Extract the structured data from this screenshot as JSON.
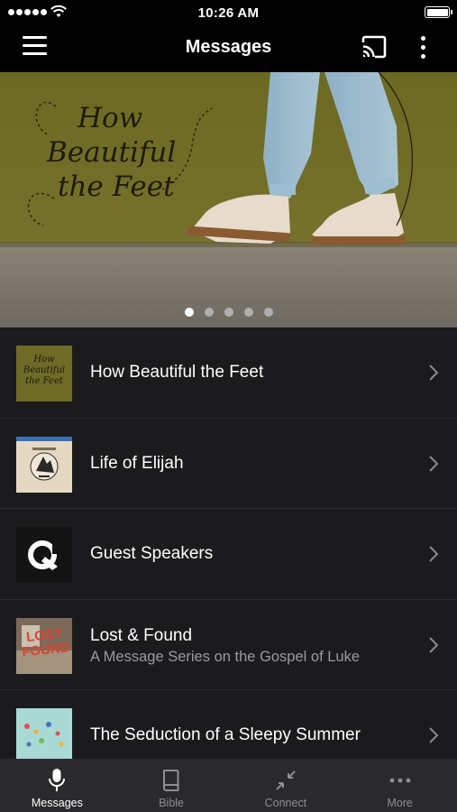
{
  "status_bar": {
    "time": "10:26 AM"
  },
  "nav": {
    "title": "Messages"
  },
  "hero": {
    "caption_line1": "How",
    "caption_line2": "Beautiful",
    "caption_line3": "the Feet",
    "page_count": 5,
    "active_page": 1
  },
  "messages": [
    {
      "title": "How Beautiful the Feet",
      "subtitle": "",
      "thumb_text": "How Beautiful the Feet"
    },
    {
      "title": "Life of Elijah",
      "subtitle": ""
    },
    {
      "title": "Guest Speakers",
      "subtitle": ""
    },
    {
      "title": "Lost & Found",
      "subtitle": "A Message Series on the Gospel of Luke",
      "thumb_text": "LOST FOUND"
    },
    {
      "title": "The Seduction of a Sleepy Summer",
      "subtitle": ""
    }
  ],
  "tabs": [
    {
      "label": "Messages",
      "icon": "microphone-icon",
      "active": true
    },
    {
      "label": "Bible",
      "icon": "book-icon",
      "active": false
    },
    {
      "label": "Connect",
      "icon": "connect-arrows-icon",
      "active": false
    },
    {
      "label": "More",
      "icon": "more-horizontal-icon",
      "active": false
    }
  ],
  "colors": {
    "background": "#1b1b1d",
    "bar": "#000000",
    "tab_bar": "#2a2a2c",
    "hero_olive": "#6f6a25",
    "inactive_label": "#8e8e93"
  }
}
